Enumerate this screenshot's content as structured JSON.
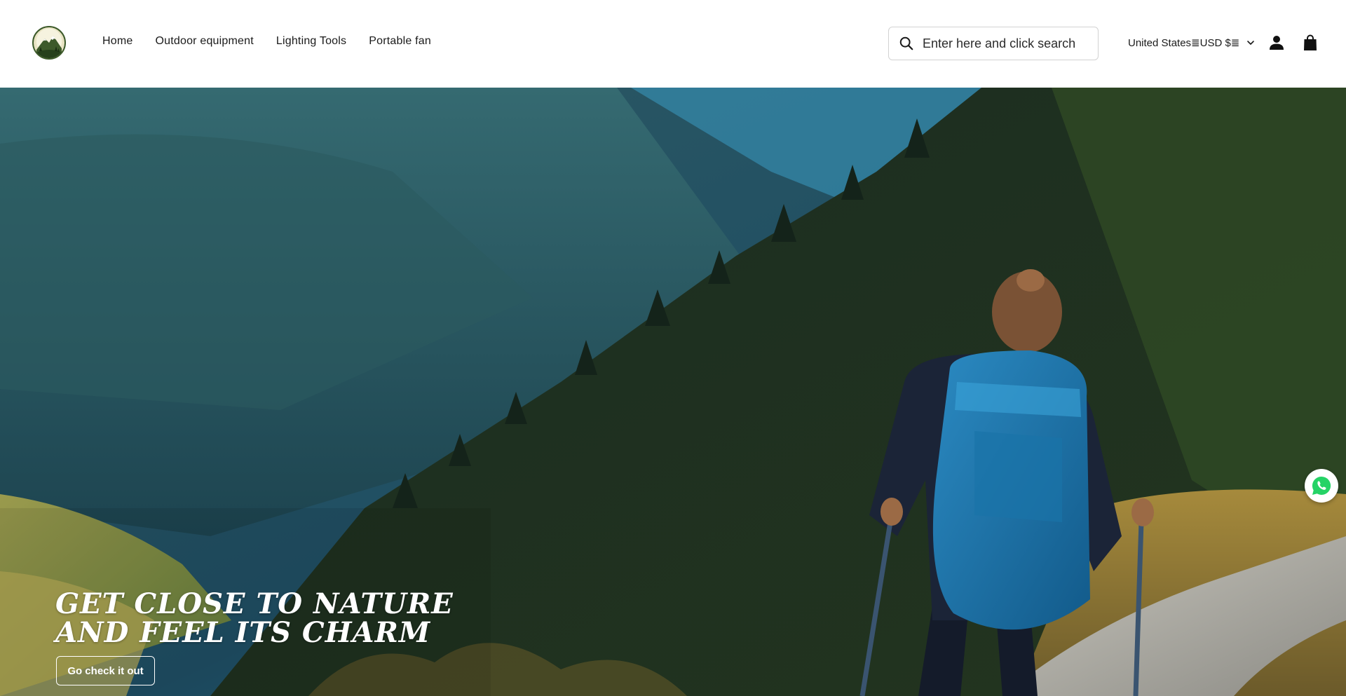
{
  "header": {
    "logo_icon": "mountain-logo-icon",
    "nav": [
      {
        "label": "Home"
      },
      {
        "label": "Outdoor equipment"
      },
      {
        "label": "Lighting Tools"
      },
      {
        "label": "Portable fan"
      }
    ],
    "search": {
      "placeholder": "Enter here and click search",
      "icon": "search-icon"
    },
    "locale": {
      "label": "United States≣USD $≣",
      "icon": "chevron-down-icon"
    },
    "account_icon": "account-icon",
    "cart_icon": "shopping-bag-icon"
  },
  "hero": {
    "title_lines": [
      "GET CLOSE TO NATURE",
      "AND FEEL ITS CHARM"
    ],
    "cta_label": "Go check it out"
  },
  "floating": {
    "whatsapp_icon": "whatsapp-icon",
    "whatsapp_color": "#25D366"
  },
  "colors": {
    "header_bg": "#ffffff",
    "text": "#1a1a1a",
    "hero_text": "#ffffff"
  }
}
